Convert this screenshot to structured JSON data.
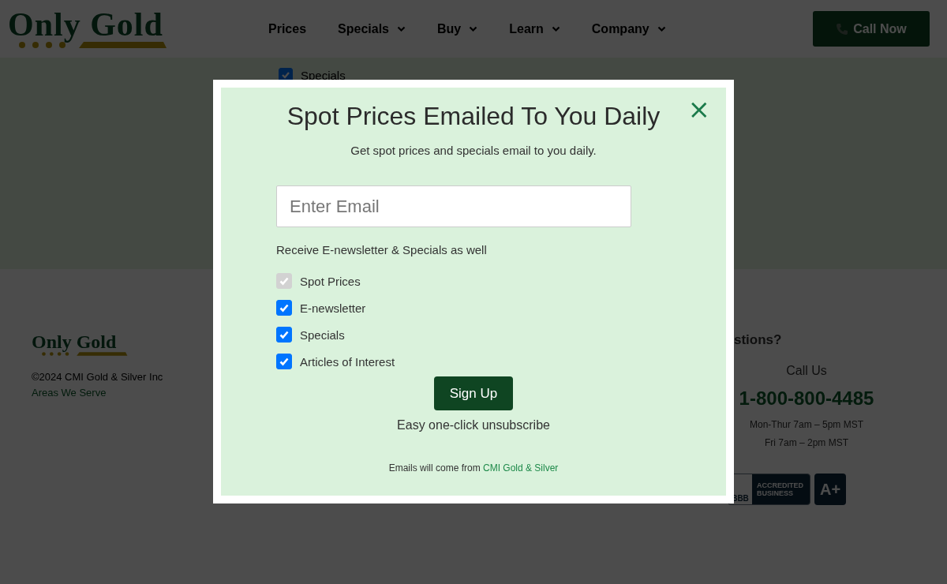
{
  "header": {
    "logo": "Only Gold",
    "nav": [
      {
        "label": "Prices",
        "dropdown": false
      },
      {
        "label": "Specials",
        "dropdown": true
      },
      {
        "label": "Buy",
        "dropdown": true
      },
      {
        "label": "Learn",
        "dropdown": true
      },
      {
        "label": "Company",
        "dropdown": true
      }
    ],
    "call_button": "Call Now"
  },
  "background_form": {
    "option": {
      "label": "Specials",
      "checked": true
    }
  },
  "footer": {
    "logo": "Only Gold",
    "copyright": "©2024 CMI Gold & Silver Inc",
    "areas_link": "Areas We Serve",
    "questions_heading": "stions?",
    "call_label": "Call Us",
    "phone": "1-800-800-4485",
    "hours": [
      "Mon-Thur 7am – 5pm MST",
      "Fri 7am – 2pm MST"
    ],
    "badge": {
      "bbb": "BBB",
      "text": "ACCREDITED BUSINESS",
      "rating": "A+"
    }
  },
  "modal": {
    "title": "Spot Prices Emailed To You Daily",
    "close": "×",
    "subtitle": "Get spot prices and specials email to you daily.",
    "email": {
      "placeholder": "Enter Email"
    },
    "options_label": "Receive E-newsletter & Specials as well",
    "options": [
      {
        "label": "Spot Prices",
        "checked": true,
        "disabled": true
      },
      {
        "label": "E-newsletter",
        "checked": true,
        "disabled": false
      },
      {
        "label": "Specials",
        "checked": true,
        "disabled": false
      },
      {
        "label": "Articles of Interest",
        "checked": true,
        "disabled": false
      }
    ],
    "submit": "Sign Up",
    "unsubscribe_note": "Easy one-click unsubscribe",
    "from_text": "Emails will come from",
    "from_link": "CMI Gold & Silver"
  }
}
